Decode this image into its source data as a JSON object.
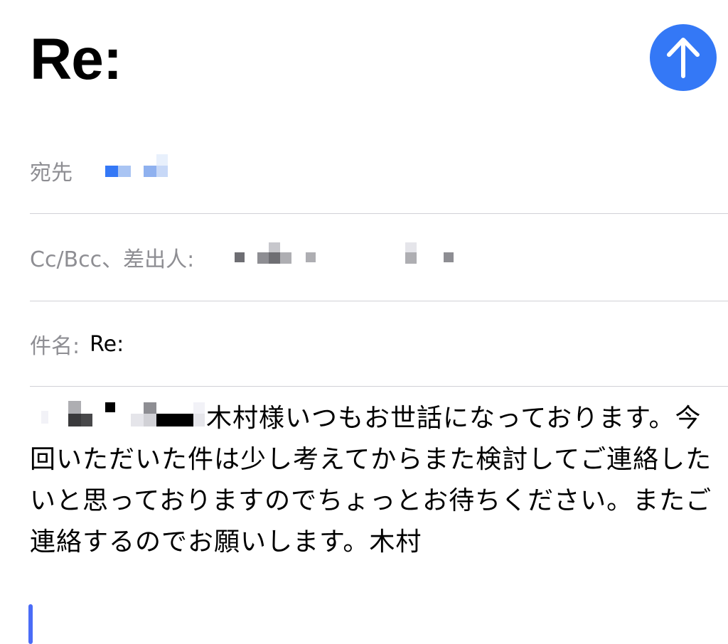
{
  "compose": {
    "title": "Re:",
    "send_icon": "arrow-up-icon",
    "accent_color": "#3478f6",
    "fields": {
      "to_label": "宛先",
      "ccbcc_label": "Cc/Bcc、差出人:",
      "subject_label": "件名:",
      "subject_value": "Re:"
    },
    "body": "木村様いつもお世話になっております。今回いただいた件は少し考えてからまた検討してご連絡したいと思っておりますのでちょっとお待ちください。またご連絡するのでお願いします。木村"
  }
}
